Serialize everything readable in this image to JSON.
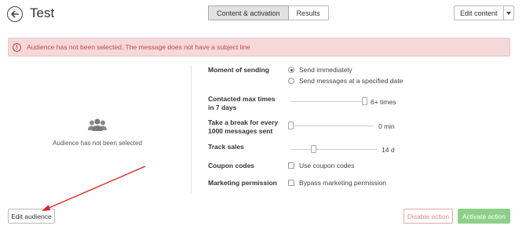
{
  "header": {
    "title": "Test",
    "tabs": [
      {
        "label": "Content & activation",
        "active": true
      },
      {
        "label": "Results",
        "active": false
      }
    ],
    "edit_content_label": "Edit content"
  },
  "alert": {
    "text": "Audience has not been selected, The message does not have a subject line",
    "color": "#c9463d"
  },
  "audience": {
    "empty_text": "Audience has not been selected",
    "icon": "users-icon",
    "edit_button_label": "Edit audience"
  },
  "settings": {
    "moment_of_sending": {
      "label": "Moment of sending",
      "options": [
        {
          "label": "Send immediately",
          "selected": true
        },
        {
          "label": "Send messages at a specified date",
          "selected": false
        }
      ]
    },
    "contacted_max": {
      "label": "Contacted max times in 7 days",
      "value_text": "6+ times",
      "level": 1.0
    },
    "take_break": {
      "label": "Take a break for every 1000 messages sent",
      "value_text": "0 min",
      "level": 0.0
    },
    "track_sales": {
      "label": "Track sales",
      "value_text": "14 d",
      "level": 0.25
    },
    "coupon_codes": {
      "label": "Coupon codes",
      "checkbox_label": "Use coupon codes",
      "checked": false
    },
    "marketing_permission": {
      "label": "Marketing permission",
      "checkbox_label": "Bypass marketing permission",
      "checked": false
    }
  },
  "footer": {
    "disable_label": "Disable action",
    "activate_label": "Activate action",
    "activate_color": "#8ed08a",
    "disable_color": "#e08a8a"
  },
  "annotation": {
    "arrow_color": "#e02020"
  }
}
